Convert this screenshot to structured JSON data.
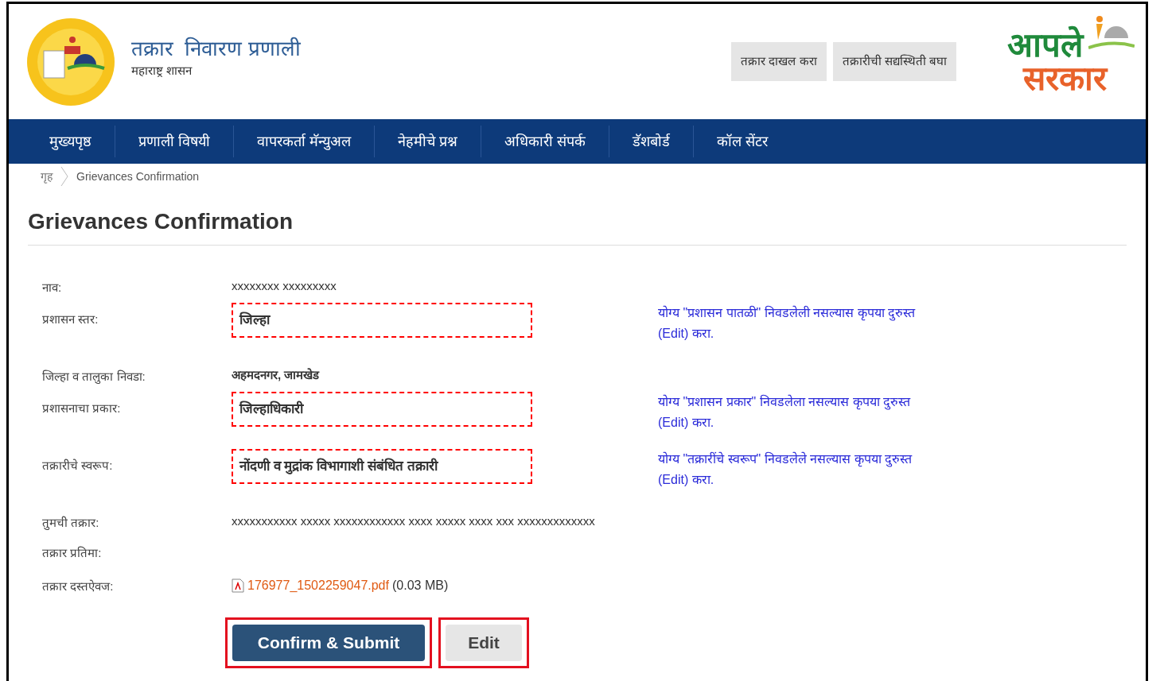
{
  "header": {
    "title": "तक्रार  निवारण प्रणाली",
    "subtitle": "महाराष्ट्र शासन",
    "buttons": [
      "तक्रार दाखल करा",
      "तक्रारीची सद्यस्थिती बघा"
    ],
    "brand": {
      "line_1": "आपले",
      "line_2": "सरकार"
    }
  },
  "nav": [
    "मुख्यपृष्ठ",
    "प्रणाली विषयी",
    "वापरकर्ता मॅन्युअल",
    "नेहमीचे प्रश्न",
    "अधिकारी संपर्क",
    "डॅशबोर्ड",
    "कॉल सेंटर"
  ],
  "breadcrumb": [
    "गृह",
    "Grievances Confirmation"
  ],
  "page_title": "Grievances Confirmation",
  "fields": [
    {
      "kind": "text",
      "label": "नाव:",
      "value": "xxxxxxxx xxxxxxxxx",
      "bold": false
    },
    {
      "kind": "flagged",
      "label": "प्रशासन स्तर:",
      "value": "जिल्हा",
      "note": "योग्य \"प्रशासन पातळी\" निवडलेली नसल्यास कृपया दुरुस्त (Edit) करा."
    },
    {
      "kind": "text",
      "label": "जिल्हा व तालुका निवडा:",
      "value": "अहमदनगर, जामखेड",
      "bold": true
    },
    {
      "kind": "flagged",
      "label": "प्रशासनाचा प्रकार:",
      "value": "जिल्हाधिकारी",
      "note": "योग्य \"प्रशासन प्रकार\" निवडलेला नसल्यास कृपया दुरुस्त (Edit) करा."
    },
    {
      "kind": "flagged",
      "label": "तक्रारीचे स्वरूप:",
      "value": "नोंदणी व मुद्रांक विभागाशी संबंधित तक्रारी",
      "note": "योग्य \"तक्रारींचे स्वरूप\" निवडलेले नसल्यास कृपया दुरुस्त (Edit) करा."
    },
    {
      "kind": "text",
      "label": "तुमची तक्रार:",
      "value": "xxxxxxxxxxx xxxxx xxxxxxxxxxxx xxxx xxxxx xxxx xxx xxxxxxxxxxxxx",
      "bold": false
    },
    {
      "kind": "empty",
      "label": "तक्रार प्रतिमा:"
    },
    {
      "kind": "file",
      "label": "तक्रार दस्तऐवज:",
      "file_name": "176977_1502259047.pdf",
      "file_size": "(0.03 MB)"
    }
  ],
  "buttons": [
    {
      "label": "Confirm & Submit",
      "kind": "primary",
      "highlighted": true
    },
    {
      "label": "Edit",
      "kind": "secondary",
      "highlighted": true
    }
  ]
}
